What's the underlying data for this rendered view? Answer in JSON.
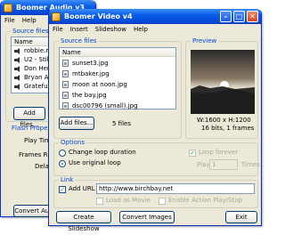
{
  "audio_window": {
    "title": "Boomer Audio v3",
    "menu": [
      "File",
      "Help"
    ],
    "source_files_label": "Source files",
    "list_header": "Name",
    "files": [
      "robbie.m",
      "U2 - Still",
      "Don Henl",
      "Bryan Ad",
      "Grateful"
    ],
    "add_files_label": "Add files...",
    "flash_properties_label": "Flash Propertie",
    "play_time_label": "Play Time",
    "frames_rate_label": "Frames Ra",
    "delay_label": "Dela",
    "convert_label": "Convert Aud"
  },
  "video_window": {
    "title": "Boomer Video v4",
    "menu": [
      "File",
      "Insert",
      "Slideshow",
      "Help"
    ],
    "source_files_label": "Source files",
    "list_header": "Name",
    "files": [
      "sunset3.jpg",
      "mtbaker.jpg",
      "moon at noon.jpg",
      "the bay.jpg",
      "dsc00796 (small).jpg"
    ],
    "add_files_label": "Add files...",
    "file_count": "5 files",
    "preview_label": "Preview",
    "preview_dims": "W:1600 x H:1200",
    "preview_info": "16 bits, 1 frames",
    "options_label": "Options",
    "option_change_loop": "Change loop duration",
    "option_original_loop": "Use original loop",
    "loop_forever_label": "Loop forever",
    "play_label": "Play",
    "play_times_value": "1",
    "times_label": "Times",
    "link_label": "Link",
    "add_url_label": "Add URL",
    "url_value": "http://www.birchbay.net",
    "load_as_movie_label": "Load as Movie",
    "enable_action_label": "Enable Action Play/Stop",
    "create_slideshow_label": "Create Slideshow",
    "convert_images_label": "Convert Images",
    "exit_label": "Exit"
  }
}
